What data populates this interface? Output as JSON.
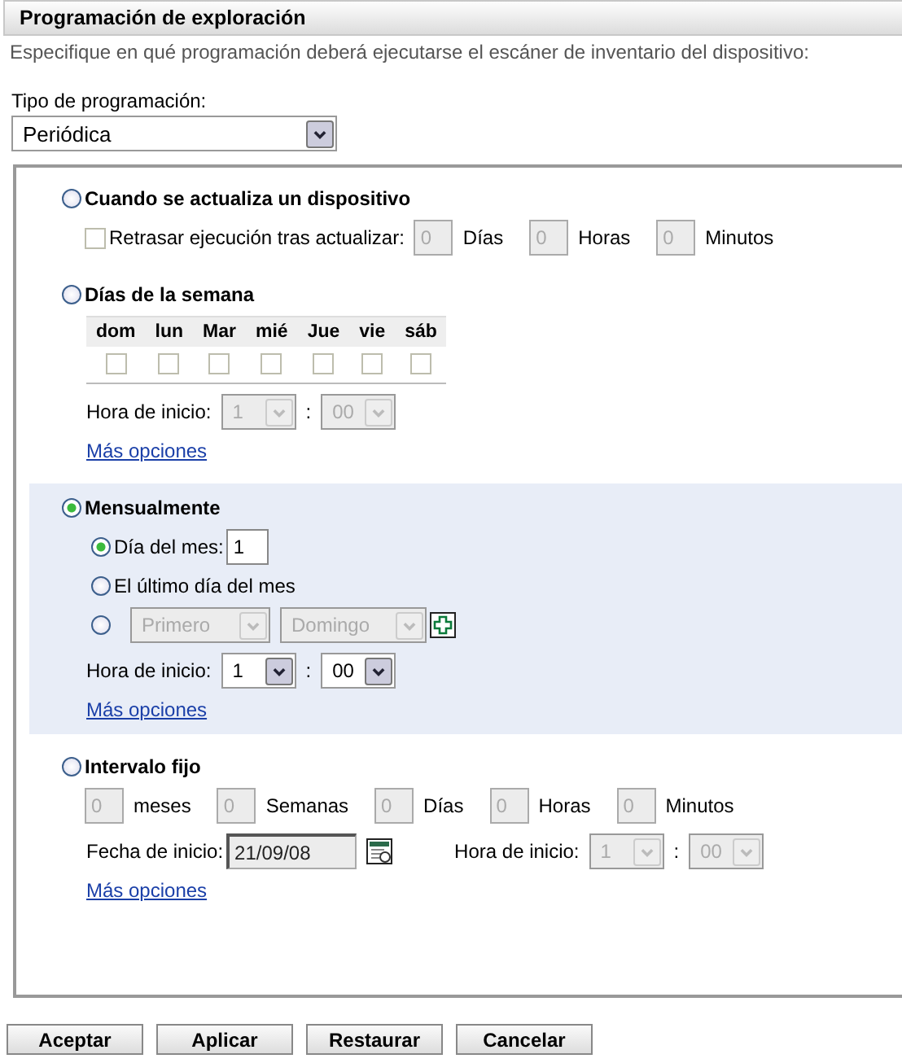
{
  "header": {
    "title": "Programación de exploración"
  },
  "description": "Especifique en qué programación deberá ejecutarse el escáner de inventario del dispositivo:",
  "schedule_type": {
    "label": "Tipo de programación:",
    "value": "Periódica"
  },
  "sections": [
    {
      "kind": "on_refresh",
      "label": "Cuando se actualiza un dispositivo",
      "selected": false,
      "delay": {
        "label": "Retrasar ejecución tras actualizar:",
        "checked": false,
        "disabled": true,
        "fields": [
          {
            "value": "0",
            "unit": "Días"
          },
          {
            "value": "0",
            "unit": "Horas"
          },
          {
            "value": "0",
            "unit": "Minutos"
          }
        ]
      }
    },
    {
      "kind": "weekdays",
      "label": "Días de la semana",
      "selected": false,
      "days": [
        {
          "label": "dom",
          "checked": false
        },
        {
          "label": "lun",
          "checked": false
        },
        {
          "label": "Mar",
          "checked": false
        },
        {
          "label": "mié",
          "checked": false
        },
        {
          "label": "Jue",
          "checked": false
        },
        {
          "label": "vie",
          "checked": false
        },
        {
          "label": "sáb",
          "checked": false
        }
      ],
      "start_time": {
        "label": "Hora de inicio:",
        "hour": "1",
        "separator": ":",
        "minute": "00",
        "disabled": true
      },
      "more_link": "Más opciones"
    },
    {
      "kind": "monthly",
      "label": "Mensualmente",
      "selected": true,
      "options": [
        {
          "kind": "day_of_month",
          "label": "Día del mes:",
          "value": "1",
          "selected": true
        },
        {
          "kind": "last_day",
          "label": "El último día del mes",
          "selected": false
        },
        {
          "kind": "nth_weekday",
          "ordinal": "Primero",
          "weekday": "Domingo",
          "disabled": true,
          "selected": false
        }
      ],
      "start_time": {
        "label": "Hora de inicio:",
        "hour": "1",
        "separator": ":",
        "minute": "00",
        "disabled": false
      },
      "more_link": "Más opciones"
    },
    {
      "kind": "fixed_interval",
      "label": "Intervalo fijo",
      "selected": false,
      "disabled": true,
      "fields": [
        {
          "value": "0",
          "unit": "meses"
        },
        {
          "value": "0",
          "unit": "Semanas"
        },
        {
          "value": "0",
          "unit": "Días"
        },
        {
          "value": "0",
          "unit": "Horas"
        },
        {
          "value": "0",
          "unit": "Minutos"
        }
      ],
      "start_date": {
        "label": "Fecha de inicio:",
        "value": "21/09/08"
      },
      "start_time": {
        "label": "Hora de inicio:",
        "hour": "1",
        "separator": ":",
        "minute": "00",
        "disabled": true
      },
      "more_link": "Más opciones"
    }
  ],
  "buttons": [
    "Aceptar",
    "Aplicar",
    "Restaurar",
    "Cancelar"
  ]
}
